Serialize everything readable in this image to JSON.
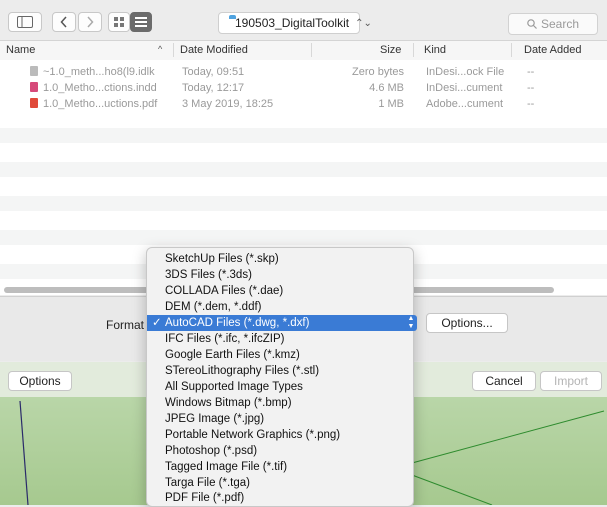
{
  "toolbar": {
    "path_label": "190503_DigitalToolkit",
    "search_placeholder": "Search"
  },
  "columns": [
    "Name",
    "Date Modified",
    "Size",
    "Kind",
    "Date Added"
  ],
  "files": [
    {
      "name": "~1.0_meth...ho8(l9.idlk",
      "modified": "Today, 09:51",
      "size": "Zero bytes",
      "kind": "InDesi...ock File",
      "added": "--",
      "icon_color": "#9a9a9a"
    },
    {
      "name": "1.0_Metho...ctions.indd",
      "modified": "Today, 12:17",
      "size": "4.6 MB",
      "kind": "InDesi...cument",
      "added": "--",
      "icon_color": "#d64a7a"
    },
    {
      "name": "1.0_Metho...uctions.pdf",
      "modified": "3 May 2019, 18:25",
      "size": "1 MB",
      "kind": "Adobe...cument",
      "added": "--",
      "icon_color": "#e04a3a"
    }
  ],
  "format": {
    "label": "Format",
    "options_button": "Options...",
    "items": [
      "SketchUp Files (*.skp)",
      "3DS Files (*.3ds)",
      "COLLADA Files (*.dae)",
      "DEM (*.dem, *.ddf)",
      "AutoCAD Files (*.dwg, *.dxf)",
      "IFC Files (*.ifc, *.ifcZIP)",
      "Google Earth Files (*.kmz)",
      "STereoLithography Files (*.stl)",
      "All Supported Image Types",
      "Windows Bitmap (*.bmp)",
      "JPEG Image (*.jpg)",
      "Portable Network Graphics (*.png)",
      "Photoshop (*.psd)",
      "Tagged Image File (*.tif)",
      "Targa File (*.tga)",
      "PDF File (*.pdf)"
    ],
    "selected_index": 4,
    "check_mark": "✓"
  },
  "bottom": {
    "options": "Options",
    "cancel": "Cancel",
    "import": "Import"
  },
  "colors": {
    "selection": "#3a7bd5",
    "viewport": "#b3d19f",
    "folder": "#4fa3e0"
  }
}
